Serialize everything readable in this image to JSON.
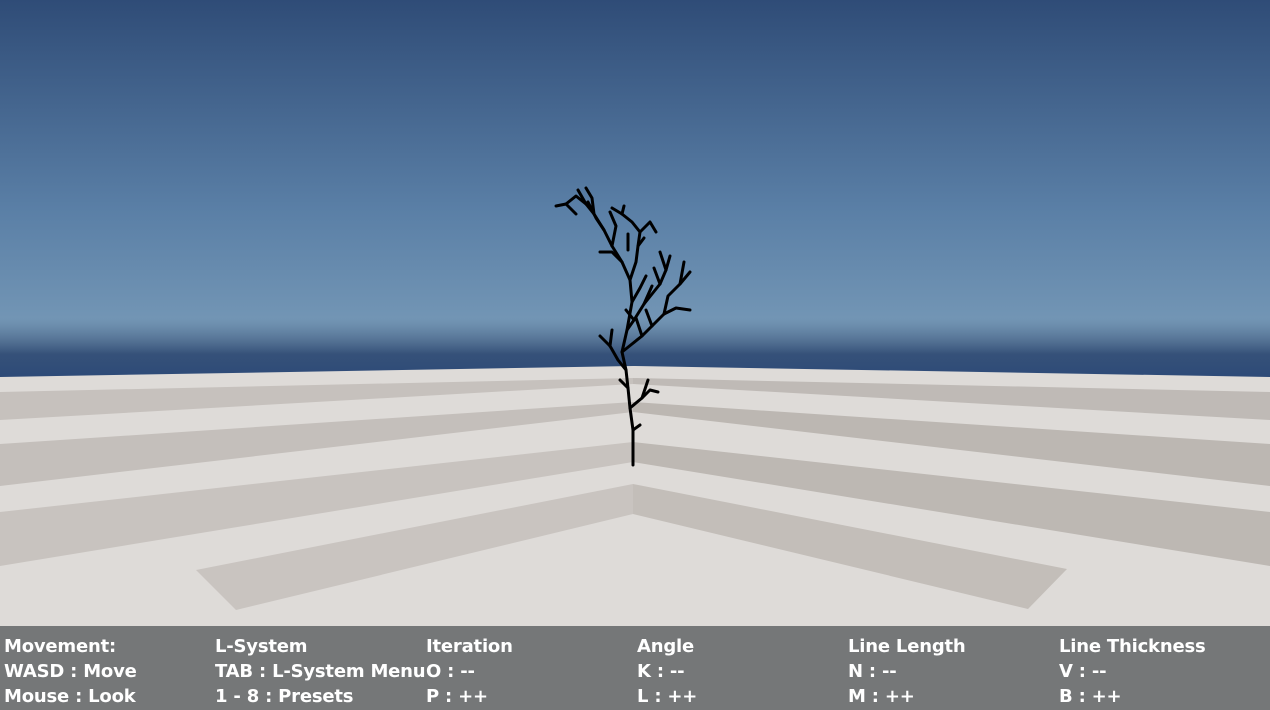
{
  "scene": {
    "sky_top_color": "#2d4b75",
    "sky_horizon_color": "#7296b6",
    "floor_color": "#dedbd8",
    "floor_shadow_color": "#c2bdb8",
    "plant_color": "#000000"
  },
  "hud": {
    "columns": [
      {
        "heading": "Movement:",
        "line1": "WASD : Move",
        "line2": "Mouse : Look"
      },
      {
        "heading": "L-System",
        "line1": "TAB : L-System Menu",
        "line2": "1 - 8 : Presets"
      },
      {
        "heading": "Iteration",
        "line1": "O : --",
        "line2": "P : ++"
      },
      {
        "heading": "Angle",
        "line1": "K : --",
        "line2": "L : ++"
      },
      {
        "heading": "Line Length",
        "line1": "N : --",
        "line2": "M : ++"
      },
      {
        "heading": "Line Thickness",
        "line1": "V : --",
        "line2": "B : ++"
      }
    ]
  }
}
